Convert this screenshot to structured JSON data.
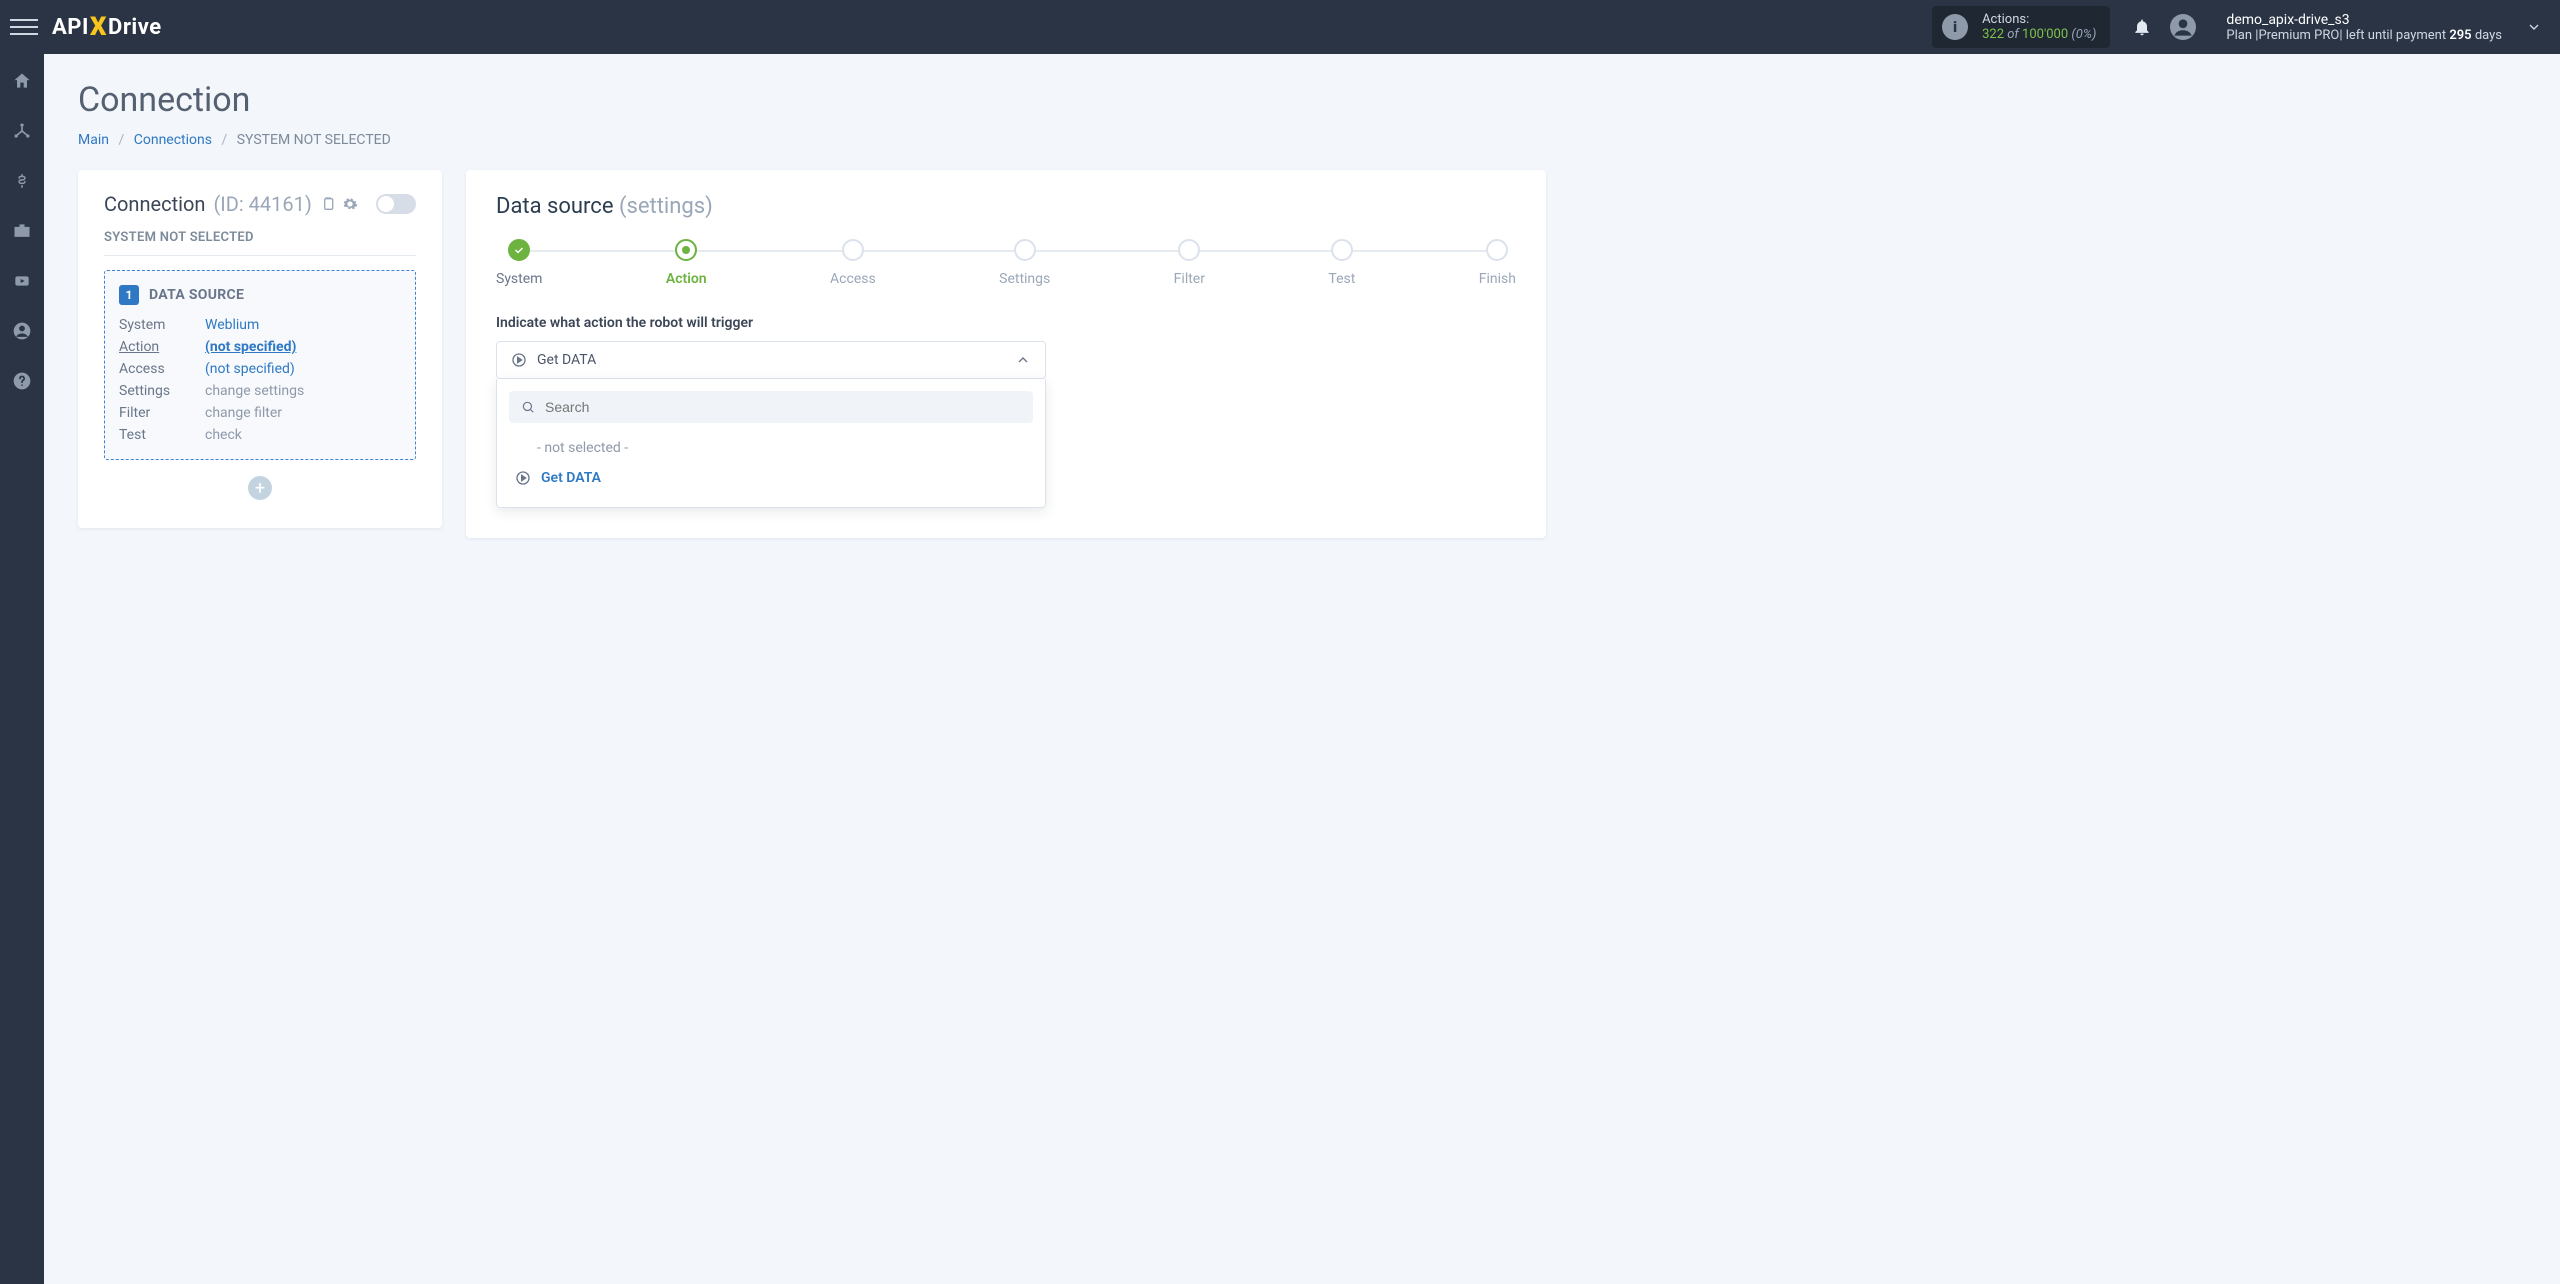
{
  "header": {
    "logo_api": "API",
    "logo_x": "X",
    "logo_drive": "Drive",
    "actions": {
      "label": "Actions:",
      "used": "322",
      "of": "of",
      "total": "100'000",
      "percent": "(0%)"
    },
    "user": {
      "name": "demo_apix-drive_s3",
      "plan_prefix": "Plan |",
      "plan_name": "Premium PRO",
      "plan_mid": "| left until payment",
      "days": "295",
      "days_suffix": "days"
    }
  },
  "page": {
    "title": "Connection",
    "breadcrumb": {
      "main": "Main",
      "connections": "Connections",
      "current": "SYSTEM NOT SELECTED"
    }
  },
  "left_card": {
    "title": "Connection",
    "id_label": "(ID: 44161)",
    "subtitle": "SYSTEM NOT SELECTED",
    "block": {
      "num": "1",
      "label": "DATA SOURCE",
      "rows": {
        "system_k": "System",
        "system_v": "Weblium",
        "action_k": "Action",
        "action_v": "(not specified)",
        "access_k": "Access",
        "access_v": "(not specified)",
        "settings_k": "Settings",
        "settings_v": "change settings",
        "filter_k": "Filter",
        "filter_v": "change filter",
        "test_k": "Test",
        "test_v": "check"
      }
    }
  },
  "right_card": {
    "title": "Data source",
    "title_muted": "(settings)",
    "steps": [
      "System",
      "Action",
      "Access",
      "Settings",
      "Filter",
      "Test",
      "Finish"
    ],
    "instruction": "Indicate what action the robot will trigger",
    "selected_value": "Get DATA",
    "search_placeholder": "Search",
    "options": {
      "not_selected": "- not selected -",
      "get_data": "Get DATA"
    }
  }
}
